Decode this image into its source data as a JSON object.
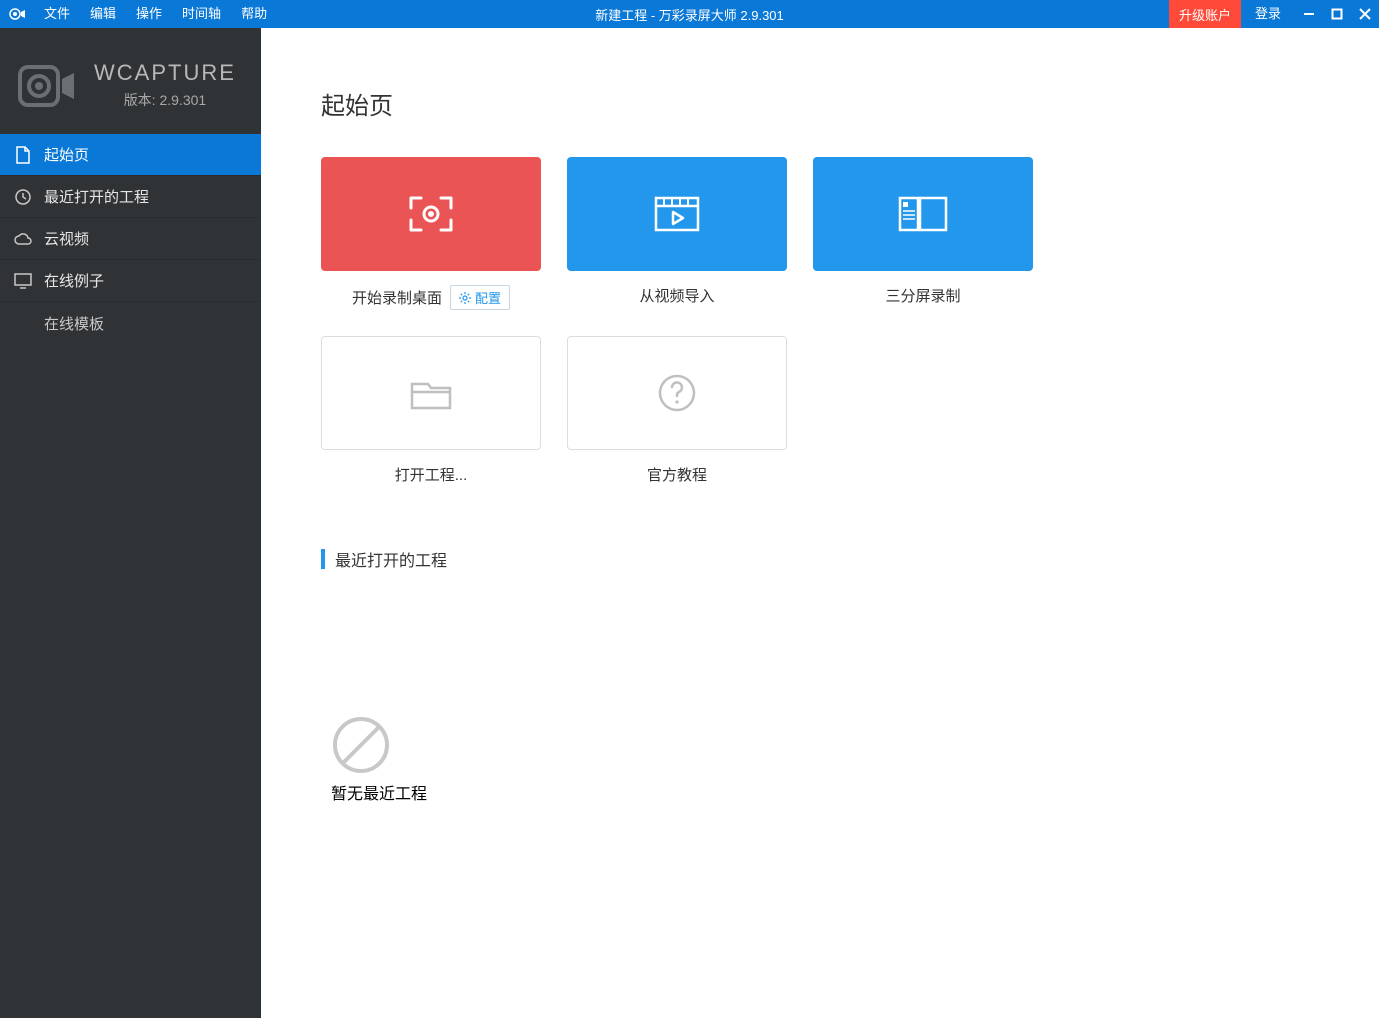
{
  "titlebar": {
    "menu": {
      "file": "文件",
      "edit": "编辑",
      "action": "操作",
      "timeline": "时间轴",
      "help": "帮助"
    },
    "title": "新建工程 - 万彩录屏大师 2.9.301",
    "upgrade": "升级账户",
    "login": "登录"
  },
  "sidebar": {
    "brand_name": "WCAPTURE",
    "brand_version": "版本: 2.9.301",
    "nav": {
      "start": "起始页",
      "recent": "最近打开的工程",
      "cloud": "云视频",
      "examples": "在线例子",
      "templates": "在线模板"
    }
  },
  "main": {
    "heading": "起始页",
    "tiles": {
      "record_desktop": "开始录制桌面",
      "config": "配置",
      "import_video": "从视频导入",
      "triple_screen": "三分屏录制",
      "open_project": "打开工程...",
      "tutorial": "官方教程"
    },
    "recent_section": "最近打开的工程",
    "empty_text": "暂无最近工程"
  }
}
